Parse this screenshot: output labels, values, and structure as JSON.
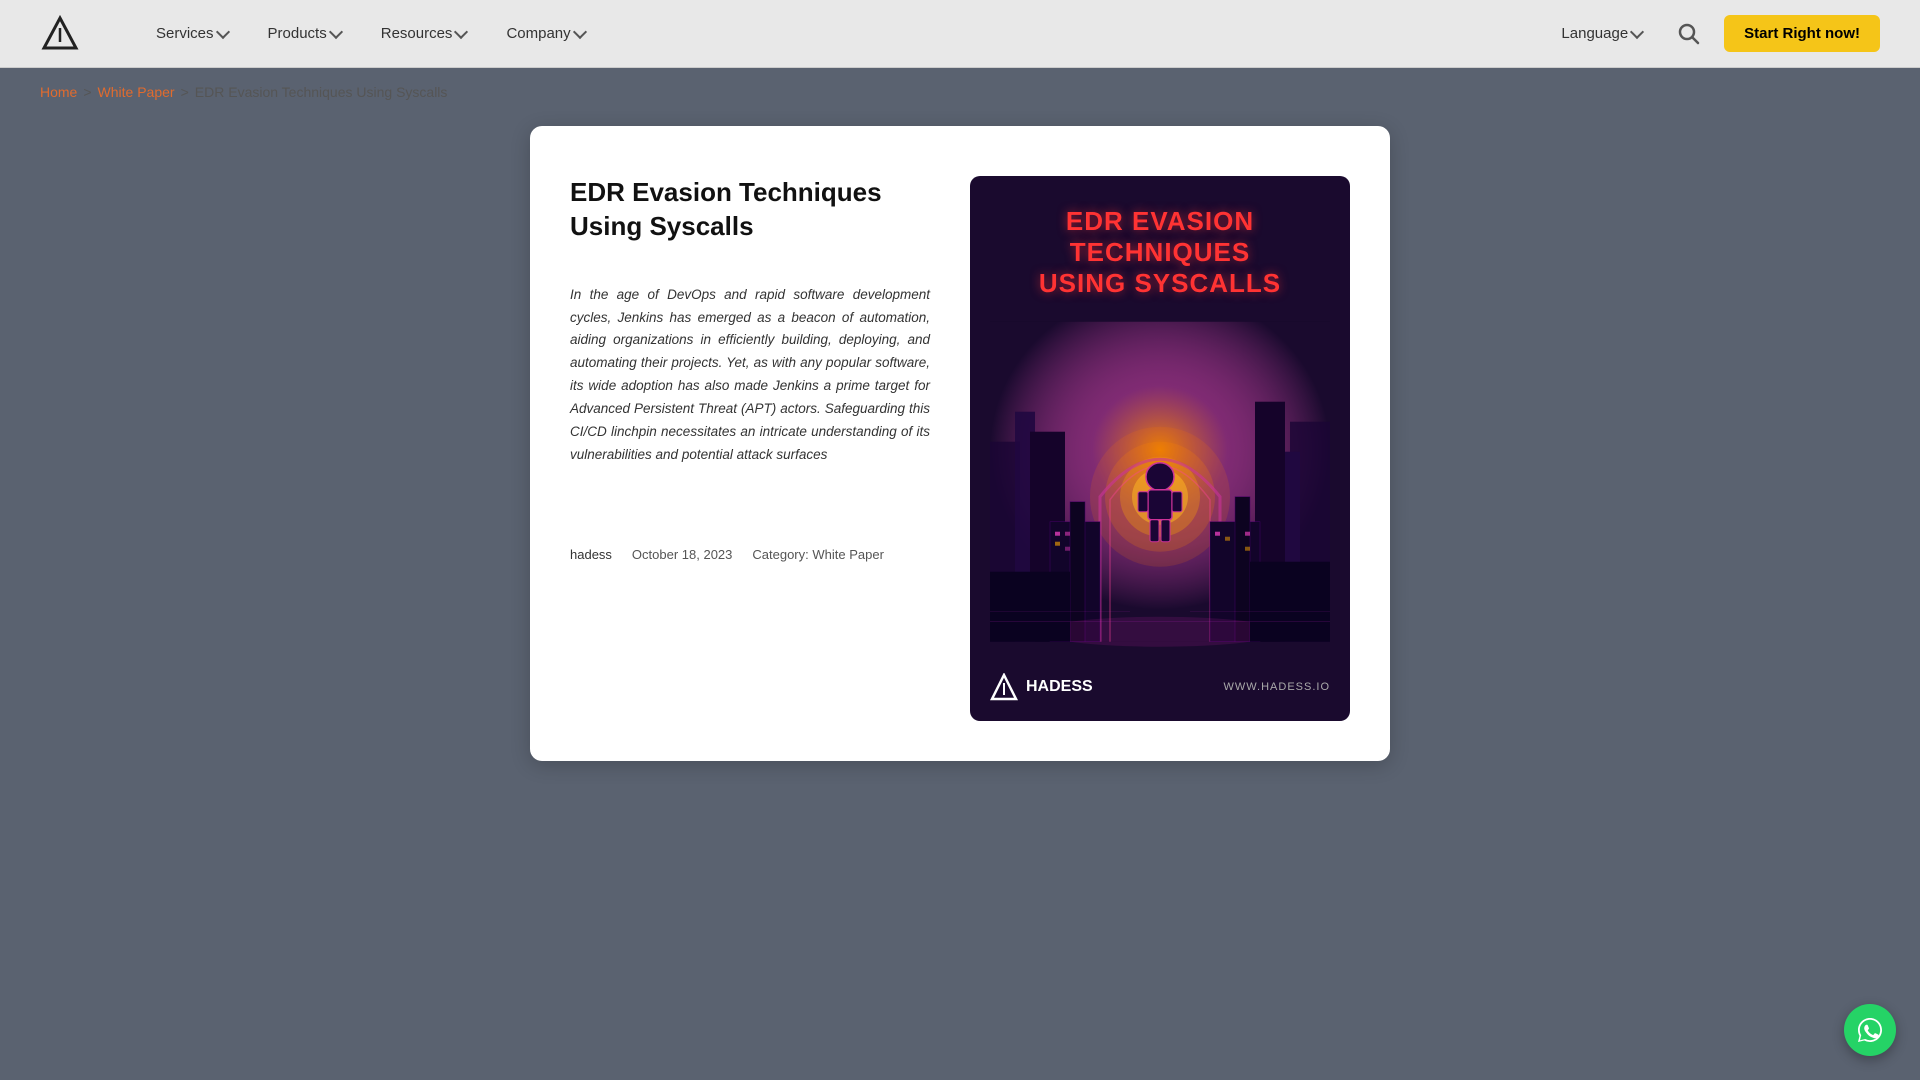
{
  "header": {
    "logo_alt": "Hadess Logo",
    "nav": [
      {
        "label": "Services",
        "id": "services"
      },
      {
        "label": "Products",
        "id": "products"
      },
      {
        "label": "Resources",
        "id": "resources"
      },
      {
        "label": "Company",
        "id": "company"
      }
    ],
    "language_label": "Language",
    "search_label": "Search",
    "cta_label": "Start Right now!"
  },
  "breadcrumb": {
    "home": "Home",
    "separator1": ">",
    "white_paper": "White Paper",
    "separator2": ">",
    "current": "EDR Evasion Techniques Using Syscalls"
  },
  "article": {
    "title": "EDR Evasion Techniques Using Syscalls",
    "description": "In the age of DevOps and rapid software development cycles, Jenkins has emerged as a beacon of automation, aiding organizations in efficiently building, deploying, and automating their projects. Yet, as with any popular software, its wide adoption has also made Jenkins a prime target for Advanced Persistent Threat (APT) actors. Safeguarding this CI/CD linchpin necessitates an intricate understanding of its vulnerabilities and potential attack surfaces",
    "author": "hadess",
    "date": "October 18, 2023",
    "category_label": "Category:",
    "category_value": "White Paper",
    "image_title_line1": "EDR EVASION TECHNIQUES",
    "image_title_line2": "USING SYSCALLS",
    "hadess_brand": "HADESS",
    "website": "WWW.HADESS.IO"
  }
}
